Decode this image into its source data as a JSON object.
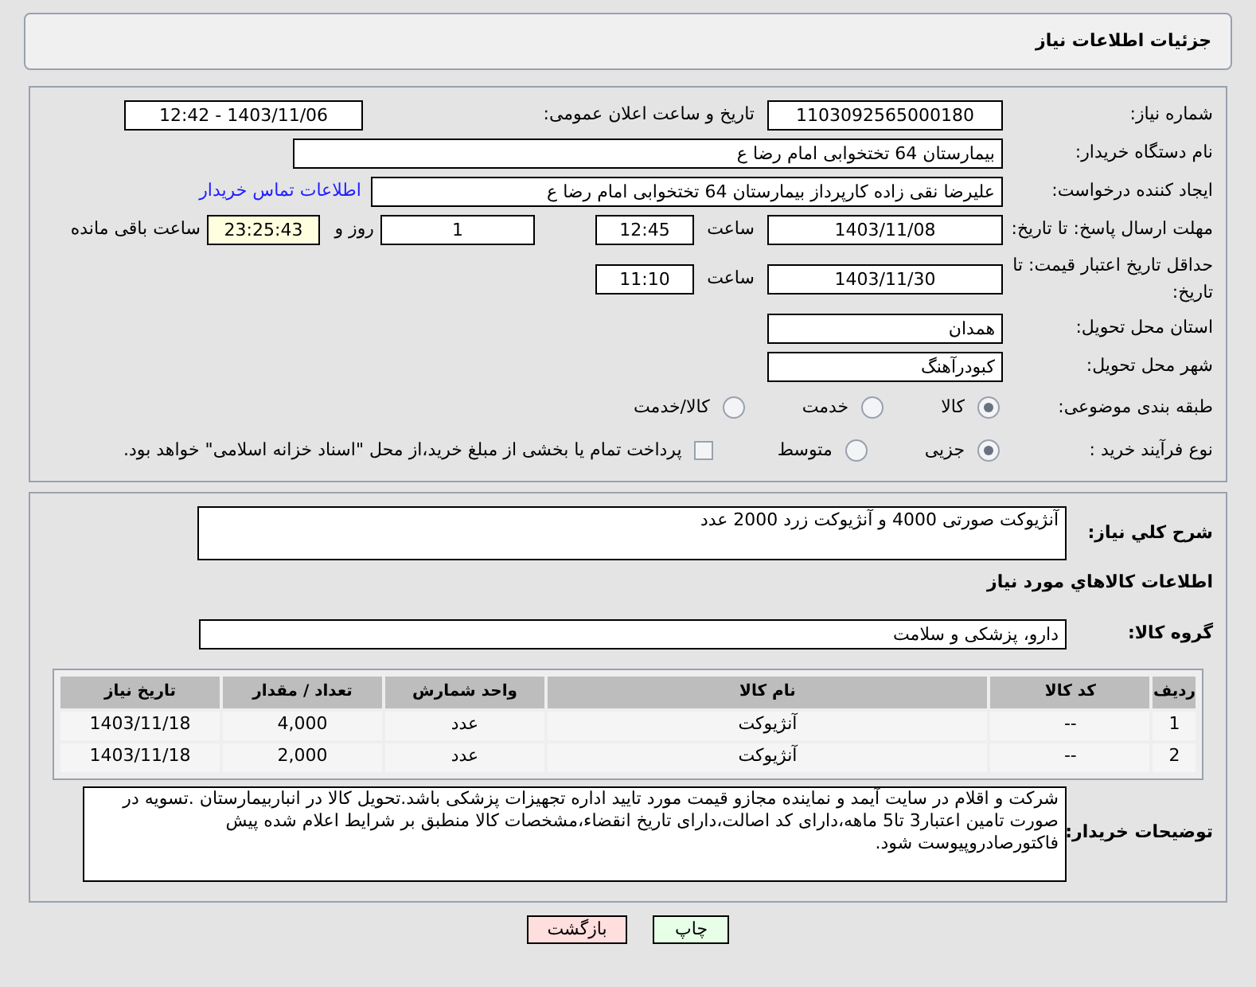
{
  "header": {
    "title": "جزئیات اطلاعات نیاز"
  },
  "form": {
    "need_number": {
      "label": "شماره نیاز:",
      "value": "1103092565000180"
    },
    "announce": {
      "label": "تاریخ و ساعت اعلان عمومی:",
      "value": "1403/11/06 - 12:42"
    },
    "buyer_org": {
      "label": "نام دستگاه خریدار:",
      "value": "بیمارستان  64 تختخوابی امام رضا   ع"
    },
    "requester": {
      "label": "ایجاد کننده درخواست:",
      "value": "علیرضا نقی زاده کارپرداز بیمارستان  64 تختخوابی امام رضا   ع",
      "link": "اطلاعات تماس خریدار"
    },
    "response_deadline": {
      "label": "مهلت ارسال پاسخ: تا تاریخ:",
      "date": "1403/11/08",
      "time_label": "ساعت",
      "time": "12:45",
      "days": "1",
      "days_label": "روز و",
      "remaining": "23:25:43",
      "remaining_label": "ساعت باقی مانده"
    },
    "price_validity": {
      "label": "حداقل تاریخ اعتبار قیمت: تا تاریخ:",
      "date": "1403/11/30",
      "time_label": "ساعت",
      "time": "11:10"
    },
    "province": {
      "label": "استان محل تحویل:",
      "value": "همدان"
    },
    "city": {
      "label": "شهر محل تحویل:",
      "value": "کبودرآهنگ"
    },
    "category": {
      "label": "طبقه بندی موضوعی:",
      "options": [
        {
          "label": "کالا",
          "selected": true
        },
        {
          "label": "خدمت",
          "selected": false
        },
        {
          "label": "کالا/خدمت",
          "selected": false
        }
      ]
    },
    "process": {
      "label": "نوع فرآیند خرید :",
      "options": [
        {
          "label": "جزیی",
          "selected": true
        },
        {
          "label": "متوسط",
          "selected": false
        }
      ],
      "payment_checkbox": {
        "checked": false,
        "text": "پرداخت تمام یا بخشی از مبلغ خرید،از محل \"اسناد خزانه اسلامی\" خواهد بود."
      }
    }
  },
  "details": {
    "description": {
      "label": "شرح کلي نياز:",
      "value": "آنژیوکت صورتی 4000 و آنژیوکت زرد 2000 عدد"
    },
    "goods_heading": "اطلاعات كالاهاي مورد نياز",
    "goods_group": {
      "label": "گروه کالا:",
      "value": "دارو، پزشکی و سلامت"
    },
    "table": {
      "columns": [
        "ردیف",
        "کد کالا",
        "نام کالا",
        "واحد شمارش",
        "تعداد / مقدار",
        "تاریخ نیاز"
      ],
      "rows": [
        [
          "1",
          "--",
          "آنژیوکت",
          "عدد",
          "4,000",
          "1403/11/18"
        ],
        [
          "2",
          "--",
          "آنژیوکت",
          "عدد",
          "2,000",
          "1403/11/18"
        ]
      ]
    },
    "buyer_notes": {
      "label": "توضیحات خریدار:",
      "value": "شرکت و اقلام در سایت آیمد و نماینده مجازو قیمت مورد تایید اداره تجهیزات پزشکی باشد.تحویل کالا در انباربیمارستان .تسویه در صورت تامین اعتبار3 تا5 ماهه،دارای کد اصالت،دارای تاریخ انقضاء،مشخصات کالا منطبق بر شرایط اعلام شده پیش فاکتورصادروپیوست شود."
    }
  },
  "buttons": [
    {
      "label": "چاپ",
      "kind": "print"
    },
    {
      "label": "بازگشت",
      "kind": "back"
    }
  ]
}
